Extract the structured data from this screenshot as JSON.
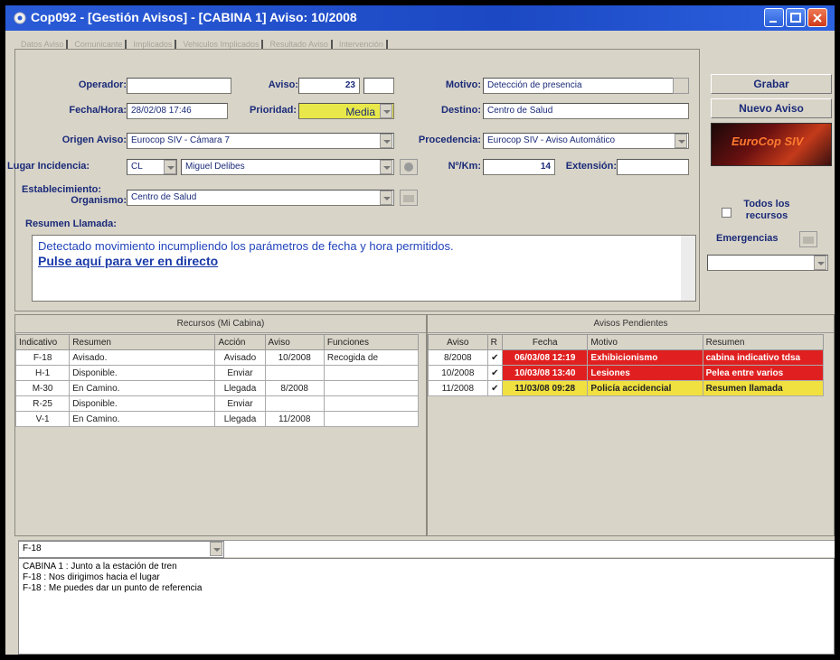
{
  "window": {
    "title": "Cop092 - [Gestión Avisos] - [CABINA 1] Aviso: 10/2008"
  },
  "tabs": [
    "Datos Aviso",
    "Comunicante",
    "Implicados",
    "Vehiculos Implicados",
    "Resultado Aviso",
    "Intervención"
  ],
  "form": {
    "operador_label": "Operador:",
    "operador_value": "",
    "aviso_label": "Aviso:",
    "aviso_value": "23",
    "motivo_label": "Motivo:",
    "motivo_value": "Detección de presencia",
    "fecha_label": "Fecha/Hora:",
    "fecha_value": "28/02/08 17:46",
    "prioridad_label": "Prioridad:",
    "prioridad_value": "Media",
    "destino_label": "Destino:",
    "destino_value": "Centro de Salud",
    "origen_label": "Origen Aviso:",
    "origen_value": "Eurocop SIV - Cámara 7",
    "procedencia_label": "Procedencia:",
    "procedencia_value": "Eurocop SIV - Aviso Automático",
    "lugar_label": "Lugar Incidencia:",
    "lugar_tipo": "CL",
    "lugar_value": "Miguel Delibes",
    "nkm_label": "Nº/Km:",
    "nkm_value": "14",
    "extension_label": "Extensión:",
    "extension_value": "",
    "establecimiento_label_1": "Establecimiento:",
    "establecimiento_label_2": "Organismo:",
    "establecimiento_value": "Centro de Salud",
    "resumen_label": "Resumen Llamada:",
    "resumen_text": "Detectado movimiento incumpliendo los parámetros de fecha y hora permitidos.",
    "resumen_link": "Pulse aquí para ver en directo"
  },
  "sidebar": {
    "grabar": "Grabar",
    "nuevo_aviso": "Nuevo Aviso",
    "logo_text": "EuroCop SIV",
    "todos_line1": "Todos los",
    "todos_line2": "recursos",
    "emergencias": "Emergencias"
  },
  "recursos": {
    "title": "Recursos (Mi Cabina)",
    "columns": [
      "Indicativo",
      "Resumen",
      "Acción",
      "Aviso",
      "Funciones"
    ],
    "rows": [
      [
        "F-18",
        "Avisado.",
        "Avisado",
        "10/2008",
        "Recogida de"
      ],
      [
        "H-1",
        "Disponible.",
        "Enviar",
        "",
        ""
      ],
      [
        "M-30",
        "En Camino.",
        "Llegada",
        "8/2008",
        ""
      ],
      [
        "R-25",
        "Disponible.",
        "Enviar",
        "",
        ""
      ],
      [
        "V-1",
        "En Camino.",
        "Llegada",
        "11/2008",
        ""
      ]
    ]
  },
  "pendientes": {
    "title": "Avisos Pendientes",
    "columns": [
      "Aviso",
      "R",
      "Fecha",
      "Motivo",
      "Resumen"
    ],
    "rows": [
      [
        "8/2008",
        "✔",
        "06/03/08 12:19",
        "Exhibicionismo",
        "cabina indicativo tdsa"
      ],
      [
        "10/2008",
        "✔",
        "10/03/08 13:40",
        "Lesiones",
        "Pelea entre varios"
      ],
      [
        "11/2008",
        "✔",
        "11/03/08 09:28",
        "Policía accidencial",
        "Resumen llamada"
      ]
    ],
    "row_colors": [
      "#e02020",
      "#e02020",
      "#f0e040"
    ]
  },
  "chat": {
    "selected": "F-18",
    "lines": [
      "CABINA 1 : Junto a la estación de tren",
      "F-18 : Nos dirigimos hacia el lugar",
      "F-18 : Me puedes dar un punto de referencia"
    ]
  }
}
